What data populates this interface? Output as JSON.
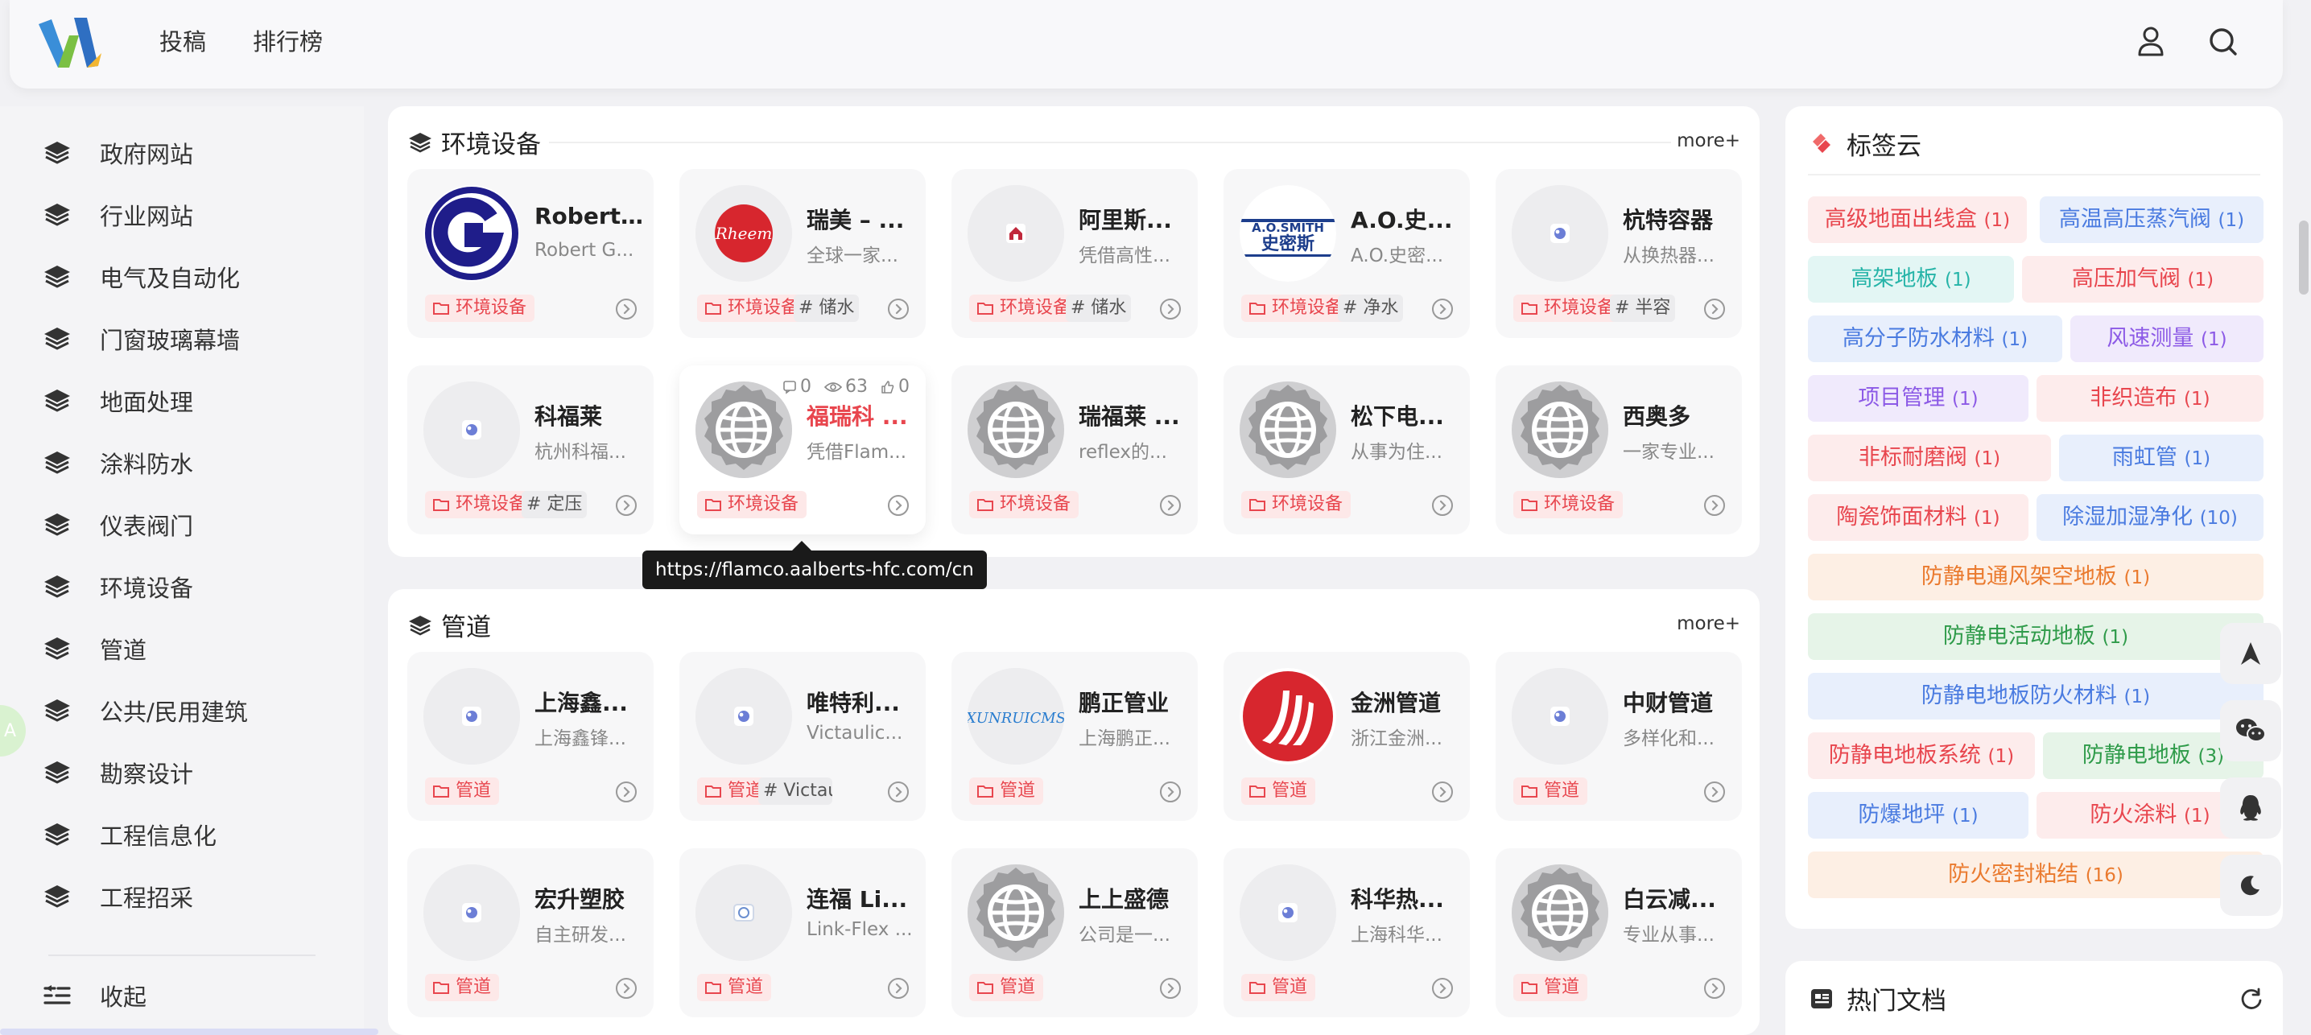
{
  "header": {
    "nav": [
      "投稿",
      "排行榜"
    ]
  },
  "sidebar": {
    "items": [
      "政府网站",
      "行业网站",
      "电气及自动化",
      "门窗玻璃幕墙",
      "地面处理",
      "涂料防水",
      "仪表阀门",
      "环境设备",
      "管道",
      "公共/民用建筑",
      "勘察设计",
      "工程信息化",
      "工程招采"
    ],
    "collapse_label": "收起"
  },
  "section_env": {
    "title": "环境设备",
    "more": "more+",
    "cards": [
      {
        "name": "Robert-...",
        "desc": "Robert G...",
        "cat": "环境设备",
        "tag": "",
        "logo": "g-logo"
      },
      {
        "name": "瑞美 – ...",
        "desc": "全球一家...",
        "cat": "环境设备",
        "tag": "# 储水",
        "logo": "rheem-logo"
      },
      {
        "name": "阿里斯...",
        "desc": "凭借高性...",
        "cat": "环境设备",
        "tag": "# 储水",
        "logo": "house-logo"
      },
      {
        "name": "A.O.史...",
        "desc": "A.O.史密...",
        "cat": "环境设备",
        "tag": "# 净水",
        "logo": "aosmith-logo"
      },
      {
        "name": "杭特容器",
        "desc": "从换热器...",
        "cat": "环境设备",
        "tag": "# 半容",
        "logo": "placeholder-logo"
      },
      {
        "name": "科福莱",
        "desc": "杭州科福...",
        "cat": "环境设备",
        "tag": "# 定压",
        "logo": "placeholder-logo"
      },
      {
        "name": "福瑞科 ...",
        "desc": "凭借Flam...",
        "cat": "环境设备",
        "tag": "",
        "logo": "globe-logo",
        "stats": {
          "comments": "0",
          "views": "63",
          "likes": "0"
        }
      },
      {
        "name": "瑞福莱 ...",
        "desc": "reflex的...",
        "cat": "环境设备",
        "tag": "",
        "logo": "globe-logo"
      },
      {
        "name": "松下电...",
        "desc": "从事为住...",
        "cat": "环境设备",
        "tag": "",
        "logo": "globe-logo"
      },
      {
        "name": "西奥多",
        "desc": "一家专业...",
        "cat": "环境设备",
        "tag": "",
        "logo": "globe-logo"
      }
    ]
  },
  "tooltip": "https://flamco.aalberts-hfc.com/cn",
  "section_pipe": {
    "title": "管道",
    "more": "more+",
    "cards": [
      {
        "name": "上海鑫...",
        "desc": "上海鑫锋...",
        "cat": "管道",
        "tag": "",
        "logo": "placeholder-logo"
      },
      {
        "name": "唯特利...",
        "desc": "Victaulic...",
        "cat": "管道",
        "tag": "# Victaulic",
        "logo": "placeholder-logo"
      },
      {
        "name": "鹏正管业",
        "desc": "上海鹏正...",
        "cat": "管道",
        "tag": "",
        "logo": "xunrui-logo"
      },
      {
        "name": "金洲管道",
        "desc": "浙江金洲...",
        "cat": "管道",
        "tag": "",
        "logo": "jinzhou-logo"
      },
      {
        "name": "中财管道",
        "desc": "多样化和...",
        "cat": "管道",
        "tag": "",
        "logo": "placeholder-logo"
      },
      {
        "name": "宏升塑胶",
        "desc": "自主研发...",
        "cat": "管道",
        "tag": "",
        "logo": "placeholder-logo"
      },
      {
        "name": "连福 Li...",
        "desc": "Link-Flex ...",
        "cat": "管道",
        "tag": "",
        "logo": "linkflex-logo"
      },
      {
        "name": "上上盛德",
        "desc": "公司是一...",
        "cat": "管道",
        "tag": "",
        "logo": "globe-logo"
      },
      {
        "name": "科华热...",
        "desc": "上海科华...",
        "cat": "管道",
        "tag": "",
        "logo": "placeholder-logo"
      },
      {
        "name": "白云减...",
        "desc": "专业从事...",
        "cat": "管道",
        "tag": "",
        "logo": "globe-logo"
      }
    ]
  },
  "tag_cloud": {
    "title": "标签云",
    "tags": [
      {
        "label": "高级地面出线盒",
        "count": "(1)",
        "color": "#e8464e",
        "bg": "#fdecec"
      },
      {
        "label": "高温高压蒸汽阀",
        "count": "(1)",
        "color": "#4a7be0",
        "bg": "#e8effc"
      },
      {
        "label": "高架地板",
        "count": "(1)",
        "color": "#26b4a8",
        "bg": "#e3f6f4"
      },
      {
        "label": "高压加气阀",
        "count": "(1)",
        "color": "#e8464e",
        "bg": "#fdecec"
      },
      {
        "label": "高分子防水材料",
        "count": "(1)",
        "color": "#4a7be0",
        "bg": "#e8effc"
      },
      {
        "label": "风速测量",
        "count": "(1)",
        "color": "#8c5ae6",
        "bg": "#f0eafc"
      },
      {
        "label": "项目管理",
        "count": "(1)",
        "color": "#8c5ae6",
        "bg": "#f0eafc"
      },
      {
        "label": "非织造布",
        "count": "(1)",
        "color": "#e8464e",
        "bg": "#fdecec"
      },
      {
        "label": "非标耐磨阀",
        "count": "(1)",
        "color": "#e8464e",
        "bg": "#fdecec"
      },
      {
        "label": "雨虹管",
        "count": "(1)",
        "color": "#4a7be0",
        "bg": "#e8effc"
      },
      {
        "label": "陶瓷饰面材料",
        "count": "(1)",
        "color": "#e8464e",
        "bg": "#fdecec"
      },
      {
        "label": "除湿加湿净化",
        "count": "(10)",
        "color": "#4a7be0",
        "bg": "#e8effc"
      },
      {
        "label": "防静电通风架空地板",
        "count": "(1)",
        "color": "#ea7a2e",
        "bg": "#fdefe4"
      },
      {
        "label": "防静电活动地板",
        "count": "(1)",
        "color": "#2f9b4a",
        "bg": "#e6f4e8"
      },
      {
        "label": "防静电地板防火材料",
        "count": "(1)",
        "color": "#4a7be0",
        "bg": "#e8effc"
      },
      {
        "label": "防静电地板系统",
        "count": "(1)",
        "color": "#e8464e",
        "bg": "#fdecec"
      },
      {
        "label": "防静电地板",
        "count": "(3)",
        "color": "#2f9b4a",
        "bg": "#e6f4e8"
      },
      {
        "label": "防爆地坪",
        "count": "(1)",
        "color": "#4a7be0",
        "bg": "#e8effc"
      },
      {
        "label": "防火涂料",
        "count": "(1)",
        "color": "#e8464e",
        "bg": "#fdecec"
      },
      {
        "label": "防火密封粘结",
        "count": "(16)",
        "color": "#ea7a2e",
        "bg": "#fdefe4"
      }
    ]
  },
  "hot_docs": {
    "title": "热门文档"
  }
}
